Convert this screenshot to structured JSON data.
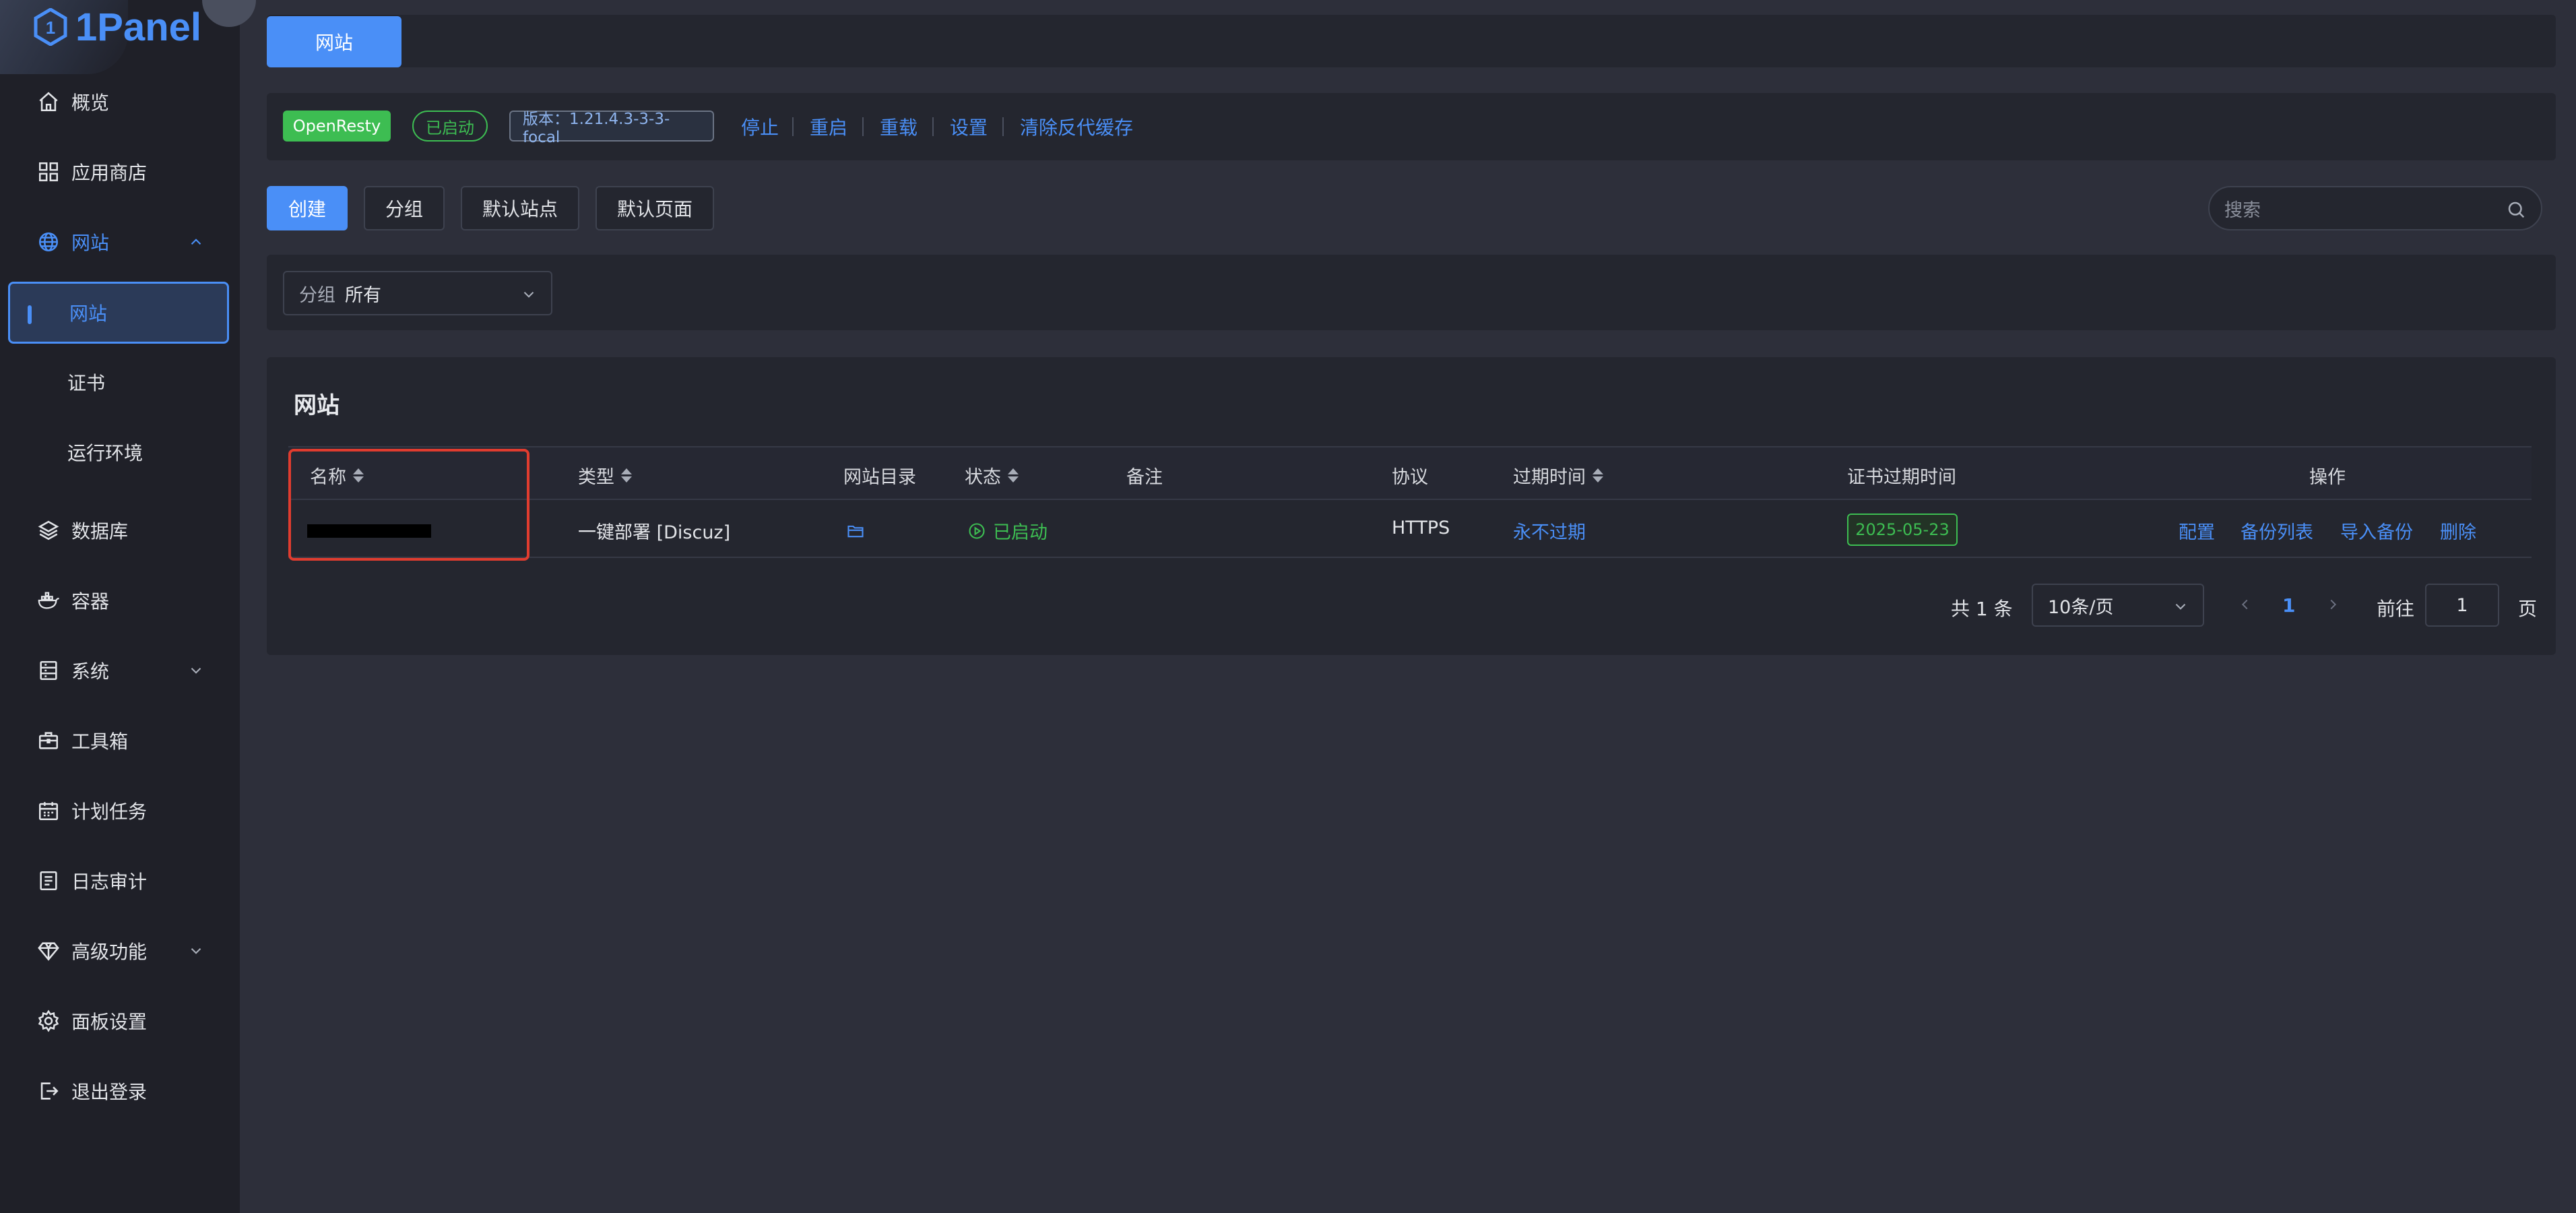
{
  "app": {
    "logo_text": "1Panel"
  },
  "sidebar": {
    "items": [
      {
        "label": "概览",
        "icon": "home-icon"
      },
      {
        "label": "应用商店",
        "icon": "grid-icon"
      },
      {
        "label": "网站",
        "icon": "globe-icon",
        "expanded": true
      },
      {
        "label": "数据库",
        "icon": "layers-icon"
      },
      {
        "label": "容器",
        "icon": "docker-icon"
      },
      {
        "label": "系统",
        "icon": "server-icon",
        "expandable": true
      },
      {
        "label": "工具箱",
        "icon": "toolbox-icon"
      },
      {
        "label": "计划任务",
        "icon": "calendar-icon"
      },
      {
        "label": "日志审计",
        "icon": "log-icon"
      },
      {
        "label": "高级功能",
        "icon": "diamond-icon",
        "expandable": true
      },
      {
        "label": "面板设置",
        "icon": "gear-icon"
      },
      {
        "label": "退出登录",
        "icon": "logout-icon"
      }
    ],
    "sub_items": [
      {
        "label": "网站",
        "active": true
      },
      {
        "label": "证书"
      },
      {
        "label": "运行环境"
      }
    ]
  },
  "tabs": {
    "active_label": "网站"
  },
  "openresty": {
    "name": "OpenResty",
    "status": "已启动",
    "version": "版本：1.21.4.3-3-3-focal",
    "actions": [
      "停止",
      "重启",
      "重载",
      "设置",
      "清除反代缓存"
    ]
  },
  "toolbar": {
    "create": "创建",
    "group": "分组",
    "default_site": "默认站点",
    "default_page": "默认页面",
    "search_placeholder": "搜索"
  },
  "filter": {
    "prefix": "分组",
    "value": "所有"
  },
  "table": {
    "title": "网站",
    "headers": [
      "名称",
      "类型",
      "网站目录",
      "状态",
      "备注",
      "协议",
      "过期时间",
      "证书过期时间",
      "操作"
    ],
    "rows": [
      {
        "name": "",
        "type": "一键部署 [Discuz]",
        "status": "已启动",
        "remark": "",
        "protocol": "HTTPS",
        "expire": "永不过期",
        "cert_expire": "2025-05-23",
        "actions": [
          "配置",
          "备份列表",
          "导入备份",
          "删除"
        ]
      }
    ]
  },
  "pager": {
    "total": "共 1 条",
    "page_size": "10条/页",
    "current_page": "1",
    "goto_label": "前往",
    "goto_value": "1",
    "page_suffix": "页"
  },
  "colors": {
    "accent": "#4a8ff7",
    "success": "#3dbd52",
    "highlight": "#e03c2f",
    "sidebar_bg": "#1f2028",
    "panel_bg": "#24262f",
    "page_bg": "#2d2f3a"
  }
}
